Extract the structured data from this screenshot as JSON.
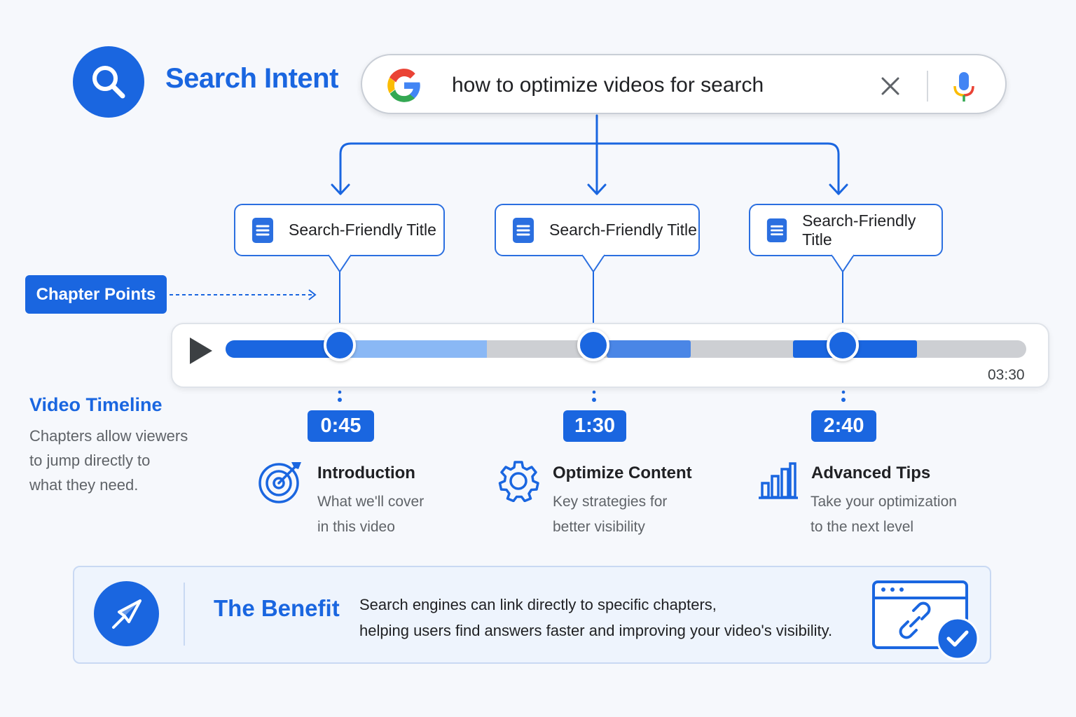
{
  "header": {
    "title": "Search Intent",
    "search_query": "how to optimize videos for search"
  },
  "cards": [
    {
      "label": "Search-Friendly Title"
    },
    {
      "label": "Search-Friendly Title"
    },
    {
      "label": "Search-Friendly Title"
    }
  ],
  "chapter_points_label": "Chapter Points",
  "player": {
    "duration": "03:30"
  },
  "timeline_info": {
    "title": "Video Timeline",
    "line1": "Chapters allow viewers",
    "line2": "to jump directly to",
    "line3": "what they need."
  },
  "chapters": [
    {
      "time": "0:45",
      "title": "Introduction",
      "desc1": "What we'll cover",
      "desc2": "in this video",
      "icon": "target-icon"
    },
    {
      "time": "1:30",
      "title": "Optimize Content",
      "desc1": "Key strategies for",
      "desc2": "better visibility",
      "icon": "gear-icon"
    },
    {
      "time": "2:40",
      "title": "Advanced Tips",
      "desc1": "Take your optimization",
      "desc2": "to the next level",
      "icon": "bar-chart-icon"
    }
  ],
  "benefit": {
    "title": "The Benefit",
    "line1": "Search engines can link directly to specific chapters,",
    "line2": "helping users find answers faster and improving your video's visibility."
  },
  "colors": {
    "primary": "#1a66e0",
    "light_blue": "#8ab8f5",
    "mid_blue": "#4a86e6",
    "track_grey": "#cdcfd3"
  }
}
